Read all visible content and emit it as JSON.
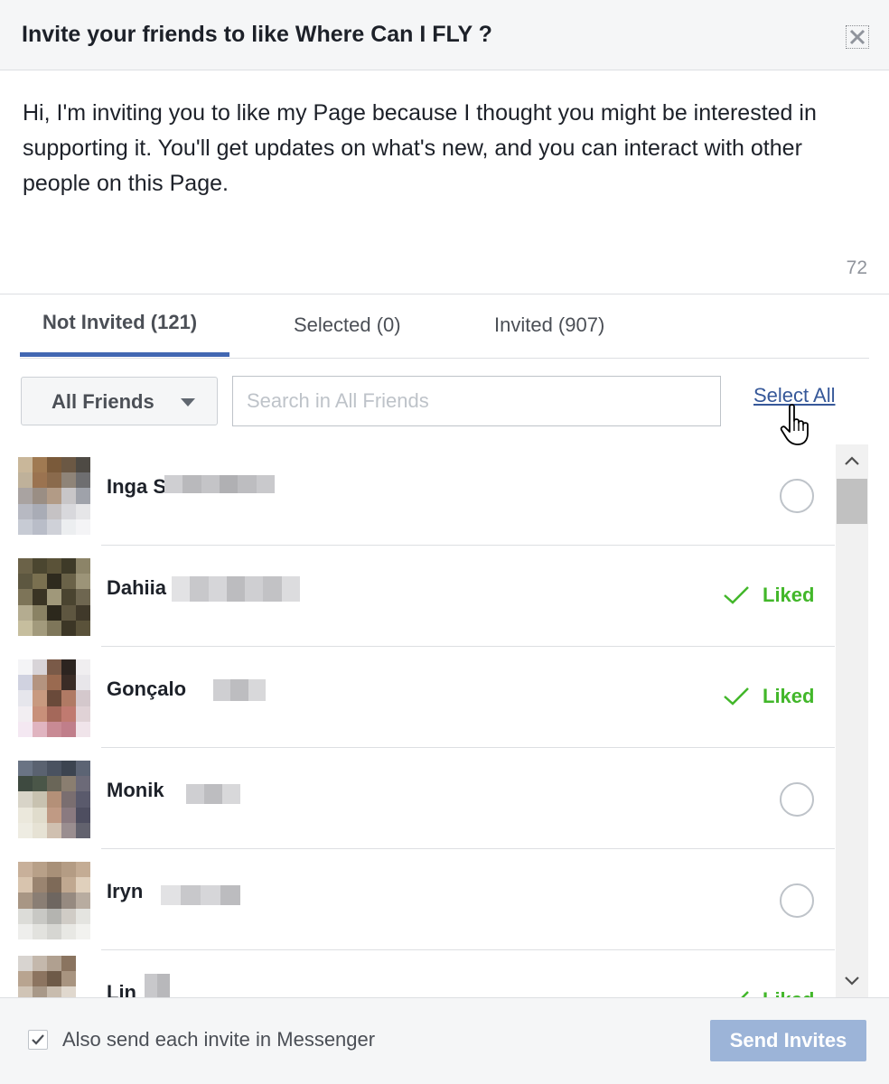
{
  "dialog": {
    "title": "Invite your friends to like Where Can I FLY ?",
    "close_icon": "close-icon"
  },
  "message": {
    "text": "Hi, I'm inviting you to like my Page because I thought you might be interested in supporting it. You'll get updates on what's new, and you can interact with other people on this Page.",
    "char_count": "72"
  },
  "tabs": [
    {
      "label": "Not Invited (121)",
      "active": true
    },
    {
      "label": "Selected (0)",
      "active": false
    },
    {
      "label": "Invited (907)",
      "active": false
    }
  ],
  "filter": {
    "label": "All Friends",
    "search_placeholder": "Search in All Friends",
    "select_all": "Select All"
  },
  "friends": [
    {
      "name": "Inga S",
      "status": "unselected"
    },
    {
      "name": "Dahiia",
      "status": "Liked"
    },
    {
      "name": "Gonçalo",
      "status": "Liked"
    },
    {
      "name": "Monik",
      "status": "unselected"
    },
    {
      "name": "Iryn",
      "status": "unselected"
    },
    {
      "name": "Lin",
      "status": "Liked"
    }
  ],
  "footer": {
    "messenger_checked": true,
    "messenger_label": "Also send each invite in Messenger",
    "send_button": "Send Invites"
  },
  "colors": {
    "accent": "#4267b2",
    "link": "#365899",
    "liked": "#42b72a",
    "send_disabled": "#9cb4d8"
  }
}
